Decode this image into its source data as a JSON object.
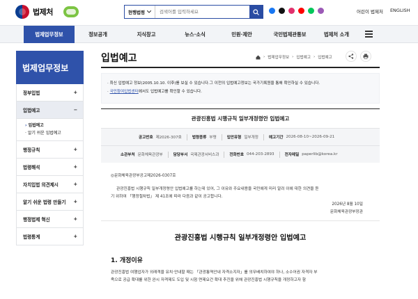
{
  "header": {
    "brand": "법제처",
    "search": {
      "scope": "현행법령",
      "placeholder": "검색어를 입력하세요"
    },
    "links": [
      "어린이 법제처",
      "ENGLISH"
    ]
  },
  "gnb": [
    "법제업무정보",
    "정보공개",
    "지식창고",
    "뉴스·소식",
    "민원·제안",
    "국민법제관통보",
    "법제처 소개"
  ],
  "sidebar": {
    "title": "법제업무정보",
    "items": [
      {
        "label": "정부입법",
        "sign": "+"
      },
      {
        "label": "입법예고",
        "sign": "−"
      },
      {
        "label": "행정규칙",
        "sign": "+"
      },
      {
        "label": "법령해석",
        "sign": "+"
      },
      {
        "label": "자치입법 의견제시",
        "sign": "+"
      },
      {
        "label": "알기 쉬운 법령 만들기",
        "sign": "+"
      },
      {
        "label": "행정법제 혁신",
        "sign": "+"
      },
      {
        "label": "법령통계",
        "sign": "+"
      }
    ],
    "sub": [
      {
        "label": "입법예고"
      },
      {
        "label": "알기 쉬운 입법예고"
      }
    ]
  },
  "content": {
    "title": "입법예고",
    "breadcrumb": [
      "법제업무정보",
      "입법예고",
      "입법예고"
    ],
    "notice_lines": [
      "· 최신 입법예고 정보(2005.10.10. 이후)를 보실 수 있습니다.그 이전의 입법예고정보는 국가기록원을 통해 확인하실 수 있습니다.",
      "국민참여입법센터",
      "에서도 입법예고를 확인할 수 있습니다."
    ],
    "item_title": "관광진흥법 시행규칙 일부개정령안 입법예고",
    "meta1": [
      {
        "k": "공고번호",
        "v": "제2026-307호"
      },
      {
        "k": "법령종류",
        "v": "부령"
      },
      {
        "k": "입안유형",
        "v": "일부개정"
      },
      {
        "k": "예고기간",
        "v": "2026-08-10~2026-09-21"
      }
    ],
    "meta2": [
      {
        "k": "소관부처",
        "v": "문화체육관광부"
      },
      {
        "k": "담당부서",
        "v": "국제관광서비스과"
      },
      {
        "k": "전화번호",
        "v": "044-203-2893"
      },
      {
        "k": "전자메일",
        "v": "paperlib@korea.kr"
      }
    ],
    "body_lines": [
      "◎문화체육관광부공고제2026-0307호",
      "관광진흥법 시행규칙 일부개정령안 입법예고를 하는데 있어, 그 이유와 주요내용을 국민에게 미리 알려 이에 대한 의견을 듣",
      "기 위하여 「행정절차법」 제 41조에 따라 다음과 같이 공고합니다."
    ],
    "date": "2026년 8월 10일",
    "issuer": "문화체육관광부장관",
    "big_title": "관광진흥법 시행규칙 일부개정령안 입법예고",
    "section": "1. 개정이유",
    "para_lines": [
      "관광진흥법 여행업자가 외래객을 유치·안내할 때는 「관광통역안내 자격소지자」를 의무배치하여야 하나, 소수어권 자격자 부",
      "족으로 공급 확대를 위한 완시 자격제도 도입 및 시험 면제요건 확대 추진을 위해 관광진흥법 시행규칙을 개정하고자 함"
    ]
  },
  "colors": {
    "primary": "#2f52aa"
  }
}
